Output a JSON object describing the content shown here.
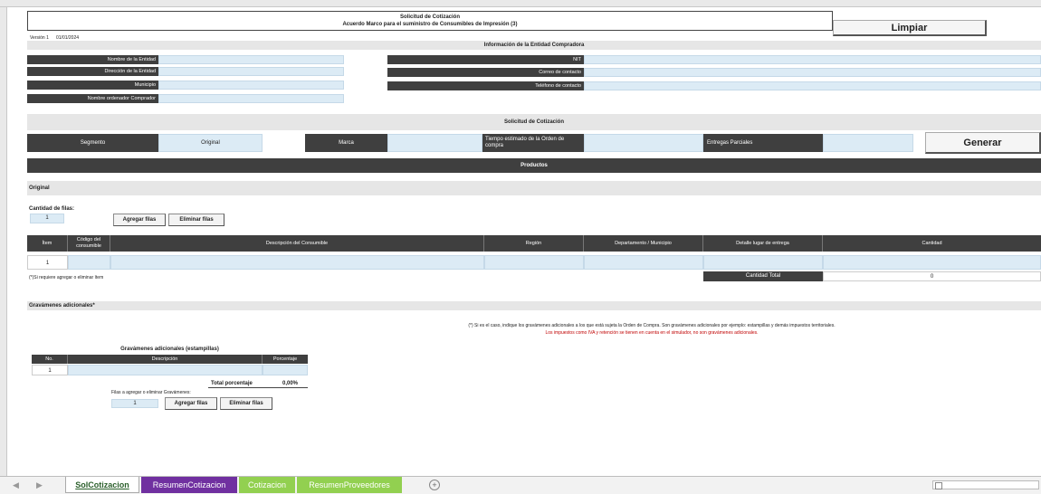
{
  "header": {
    "title_line1": "Solicitud de Cotización",
    "title_line2": "Acuerdo Marco para el suministro de Consumibles de Impresión (3)",
    "version_label": "Versión 1",
    "version_date": "01/01/2024",
    "limpiar_label": "Limpiar"
  },
  "entity": {
    "section_title": "Información de la Entidad Compradora",
    "left_labels": [
      "Nombre de la Entidad",
      "Dirección de la Entidad",
      "Municipio",
      "Nombre ordenador Comprador"
    ],
    "right_labels": [
      "NIT",
      "Correo de contacto",
      "Teléfono de contacto"
    ]
  },
  "solicitud": {
    "section_title": "Solicitud de Cotización",
    "segmento_label": "Segmento",
    "segmento_value": "Original",
    "marca_label": "Marca",
    "tiempo_label": "Tiempo estimado de la Orden de compra",
    "entregas_label": "Entregas Parciales",
    "generar_label": "Generar"
  },
  "productos": {
    "section_title": "Productos",
    "segment_name": "Original",
    "cantidad_filas_label": "Cantidad de filas:",
    "cantidad_filas_value": "1",
    "agregar_label": "Agregar filas",
    "eliminar_label": "Eliminar filas",
    "columns": [
      "Ítem",
      "Código del consumible",
      "Descripción del Consumible",
      "Región",
      "Departamento / Municipio",
      "Detalle lugar de entrega",
      "Cantidad"
    ],
    "rows": [
      {
        "item": "1"
      }
    ],
    "note": "(*)Si requiere agregar o eliminar ítem",
    "total_label": "Cantidad Total",
    "total_value": "0"
  },
  "gravamenes": {
    "section_title": "Gravámenes adicionales*",
    "info_line": "(*) Si es el caso, indique los gravámenes adicionales a los que está sujeta la Orden de Compra. Son gravámenes adicionales por ejemplo: estampillas y demás impuestos territoriales.",
    "warning_line": "Los impuestos como IVA y retención se tienen en cuenta en el simulador, no son gravámenes adicionales.",
    "table_title": "Gravámenes adicionales (estampillas)",
    "columns": [
      "No.",
      "Descripción",
      "Porcentaje"
    ],
    "rows": [
      {
        "no": "1"
      }
    ],
    "total_label": "Total porcentaje",
    "total_value": "0,00%",
    "filas_label": "Filas a agregar o eliminar Gravámenes:",
    "filas_value": "1",
    "agregar_label": "Agregar filas",
    "eliminar_label": "Eliminar filas"
  },
  "tabs": [
    {
      "label": "SolCotizacion",
      "color": "#ffffff"
    },
    {
      "label": "ResumenCotizacion",
      "color": "#7030a0"
    },
    {
      "label": "Cotizacion",
      "color": "#92d050"
    },
    {
      "label": "ResumenProveedores",
      "color": "#92d050"
    }
  ],
  "colors": {
    "dark": "#3f3f3f",
    "light_field": "#dcebf5",
    "warning": "#c00000"
  }
}
